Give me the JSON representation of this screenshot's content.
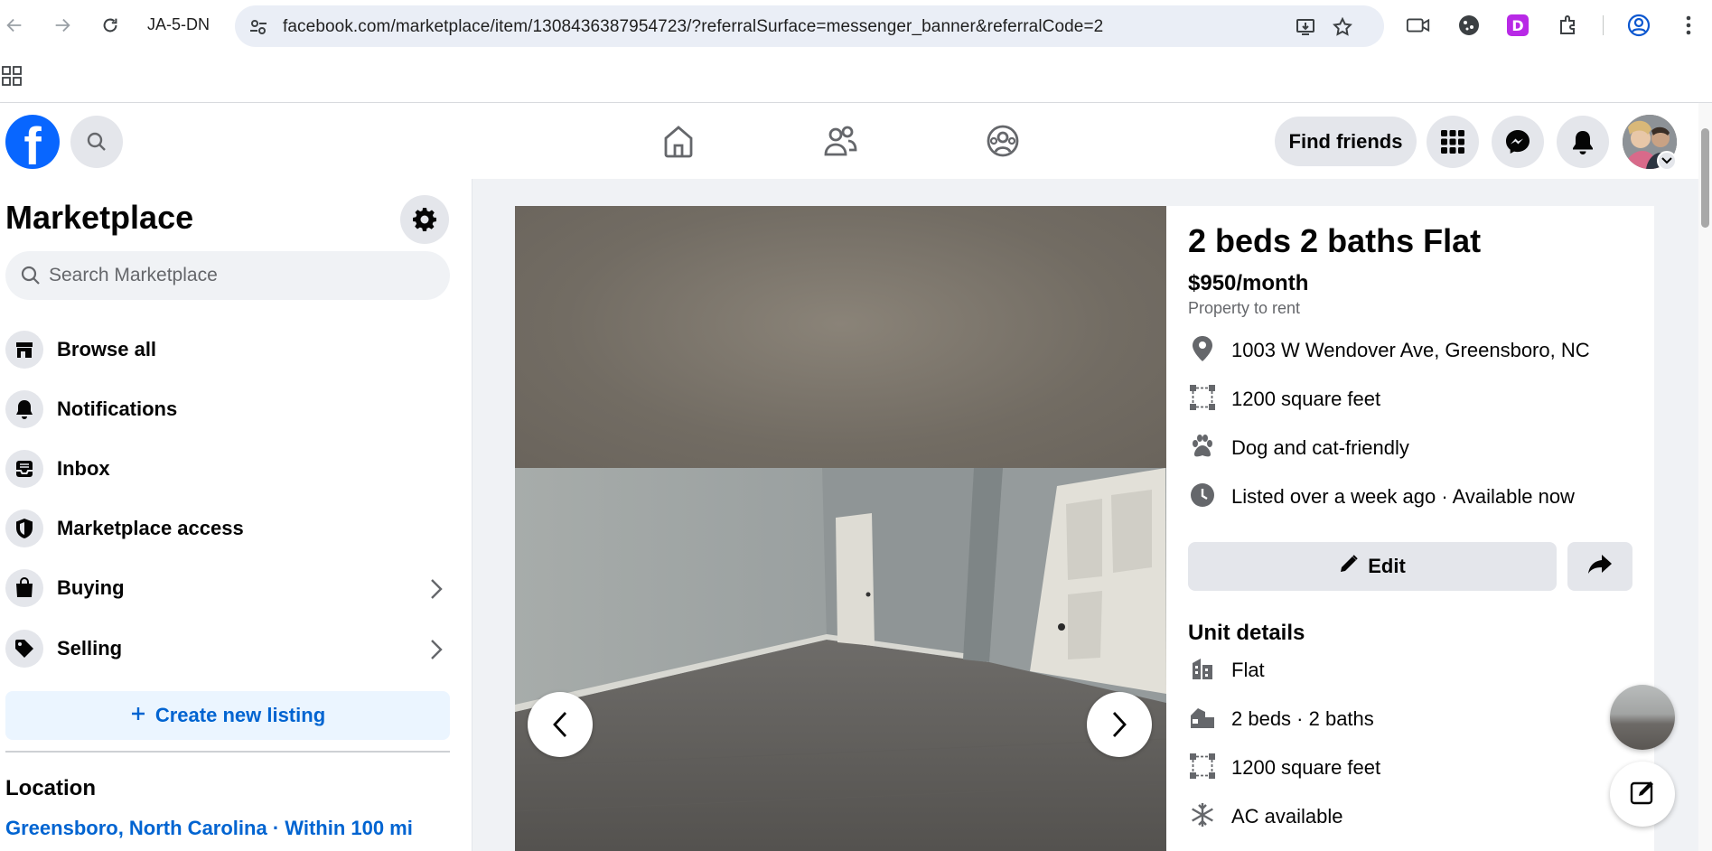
{
  "browser": {
    "tab_label": "JA-5-DN",
    "url": "facebook.com/marketplace/item/1308436387954723/?referralSurface=messenger_banner&referralCode=2"
  },
  "header": {
    "find_friends_label": "Find friends"
  },
  "sidebar": {
    "title": "Marketplace",
    "search_placeholder": "Search Marketplace",
    "items": [
      {
        "label": "Browse all",
        "icon": "storefront-icon"
      },
      {
        "label": "Notifications",
        "icon": "bell-icon"
      },
      {
        "label": "Inbox",
        "icon": "inbox-icon"
      },
      {
        "label": "Marketplace access",
        "icon": "shield-icon"
      },
      {
        "label": "Buying",
        "icon": "shopping-bag-icon"
      },
      {
        "label": "Selling",
        "icon": "tag-icon"
      }
    ],
    "create_listing_label": "Create new listing",
    "location_title": "Location",
    "location_value": "Greensboro, North Carolina · Within 100 mi"
  },
  "listing": {
    "title": "2 beds 2 baths Flat",
    "price": "$950/month",
    "category": "Property to rent",
    "address": "1003 W Wendover Ave, Greensboro, NC",
    "size": "1200 square feet",
    "pets": "Dog and cat-friendly",
    "listed": "Listed over a week ago · Available now",
    "edit_label": "Edit",
    "unit_details_title": "Unit details",
    "unit_details": [
      {
        "text": "Flat",
        "icon": "building-icon"
      },
      {
        "text": "2 beds · 2 baths",
        "icon": "bed-icon"
      },
      {
        "text": "1200 square feet",
        "icon": "area-icon"
      },
      {
        "text": "AC available",
        "icon": "snowflake-icon"
      }
    ]
  },
  "colors": {
    "fb_blue": "#0866ff",
    "link_blue": "#0064d1",
    "surface": "#f0f2f5",
    "button_gray": "#e4e6eb"
  }
}
